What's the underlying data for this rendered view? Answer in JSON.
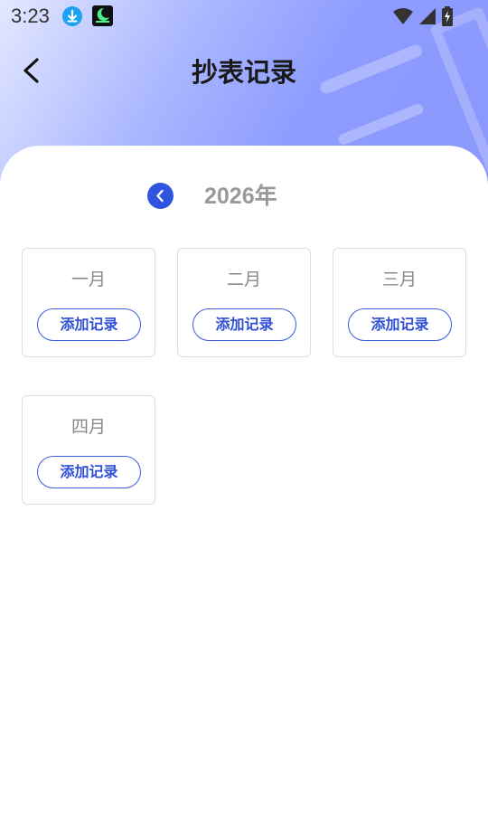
{
  "status_bar": {
    "time": "3:23",
    "icons": [
      "download-icon",
      "app-notification-icon",
      "wifi-icon",
      "cellular-signal-icon",
      "battery-charging-icon"
    ]
  },
  "header": {
    "title": "抄表记录",
    "back_icon": "chevron-left-icon"
  },
  "year_selector": {
    "prev_icon": "chevron-left-icon",
    "year": "2026年"
  },
  "months": [
    {
      "name": "一月",
      "button": "添加记录"
    },
    {
      "name": "二月",
      "button": "添加记录"
    },
    {
      "name": "三月",
      "button": "添加记录"
    },
    {
      "name": "四月",
      "button": "添加记录"
    }
  ],
  "colors": {
    "accent": "#2f55e0",
    "header_gradient_start": "#e3e8ff",
    "header_gradient_end": "#8a97fb",
    "muted_text": "#888888"
  }
}
